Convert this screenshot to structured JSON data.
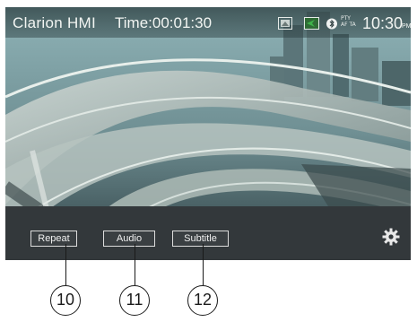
{
  "status_bar": {
    "app_title": "Clarion HMI",
    "time_label": "Time:00:01:30",
    "source_icon": "video-source-icon",
    "nav_icon": "navigation-icon",
    "bluetooth_icon": "bluetooth-icon",
    "pty_label": "PTY",
    "af_ta_label": "AF TA",
    "clock": "10:30",
    "clock_ampm": "PM"
  },
  "controls": {
    "repeat_label": "Repeat",
    "audio_label": "Audio",
    "subtitle_label": "Subtitle",
    "settings_icon": "gear-icon"
  },
  "callouts": {
    "repeat_number": "10",
    "audio_number": "11",
    "subtitle_number": "12"
  },
  "colors": {
    "status_bar": "#3a5356",
    "control_bar": "#33383b",
    "nav_icon_green": "#3fb24a"
  }
}
